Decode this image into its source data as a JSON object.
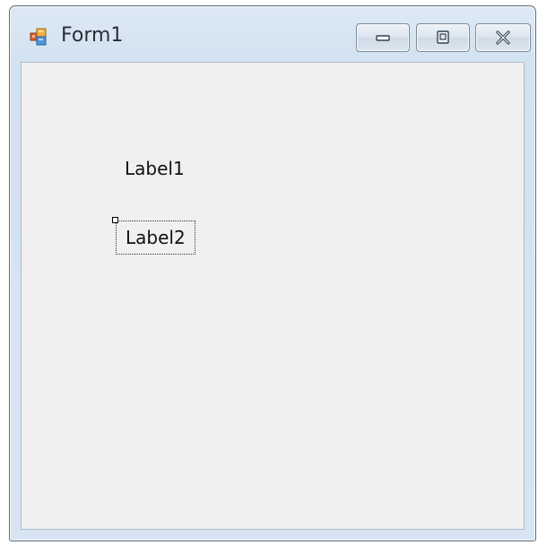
{
  "window": {
    "title": "Form1",
    "icon": "form-app-icon",
    "controls": {
      "minimize": "minimize-icon",
      "maximize": "maximize-icon",
      "close": "close-icon"
    }
  },
  "form": {
    "labels": [
      {
        "text": "Label1",
        "selected": false
      },
      {
        "text": "Label2",
        "selected": true
      }
    ]
  },
  "colors": {
    "client_background": "#f0f0f0",
    "frame_background": "#d7e4f2",
    "text": "#111111"
  }
}
